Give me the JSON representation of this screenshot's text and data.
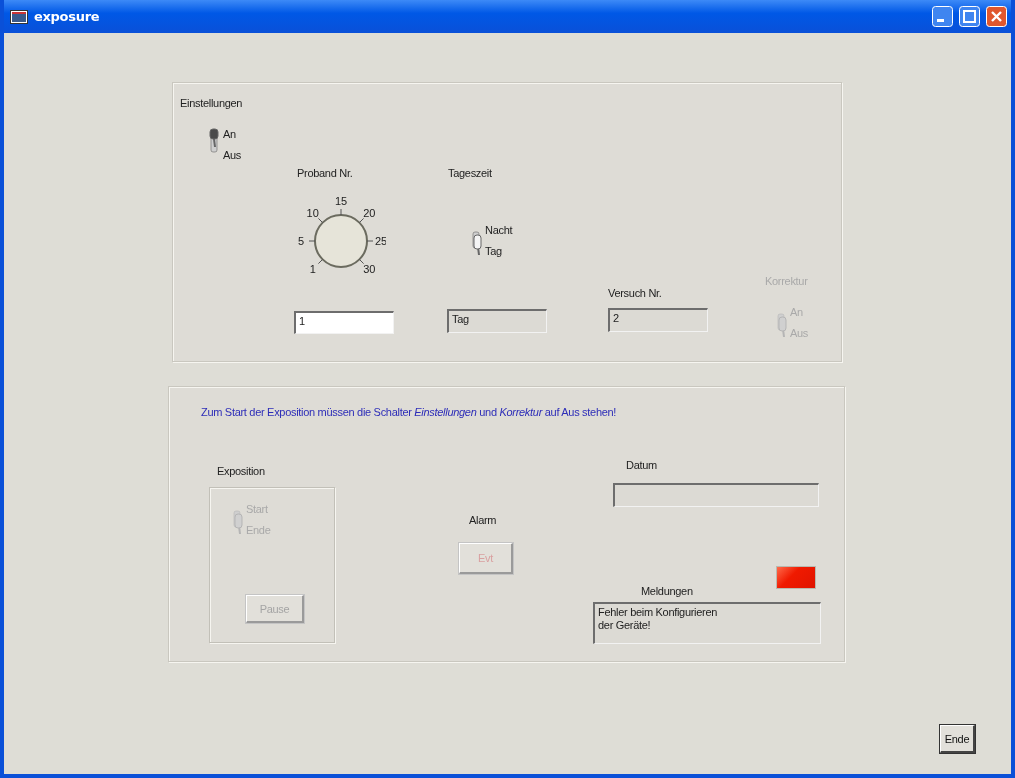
{
  "window": {
    "title": "exposure"
  },
  "settings_panel": {
    "einstellungen": {
      "label": "Einstellungen",
      "on_label": "An",
      "off_label": "Aus",
      "on": true,
      "disabled": false
    },
    "proband": {
      "label": "Proband Nr.",
      "ticks": [
        "1",
        "5",
        "10",
        "15",
        "20",
        "25",
        "30"
      ],
      "value": "1"
    },
    "tageszeit": {
      "label": "Tageszeit",
      "on_label": "Nacht",
      "off_label": "Tag",
      "on": false,
      "disabled": false,
      "display": "Tag"
    },
    "versuch": {
      "label": "Versuch Nr.",
      "value": "2"
    },
    "korrektur": {
      "label": "Korrektur",
      "on_label": "An",
      "off_label": "Aus",
      "on": false,
      "disabled": true
    }
  },
  "exposure_panel": {
    "instruction": "Zum Start der Exposition müssen die Schalter  *Einstellungen*  und  *Korrektur*  auf Aus stehen!",
    "exposition": {
      "label": "Exposition",
      "on_label": "Start",
      "off_label": "Ende",
      "on": false,
      "disabled": true,
      "pause_button": {
        "label": "Pause",
        "disabled": true
      }
    },
    "alarm": {
      "label": "Alarm",
      "button": {
        "label": "Evt",
        "disabled": true
      }
    },
    "datum": {
      "label": "Datum"
    },
    "meldungen": {
      "label": "Meldungen",
      "led_on": true,
      "text": "Fehler beim Konfigurieren\nder Geräte!"
    }
  },
  "end_button": "Ende"
}
